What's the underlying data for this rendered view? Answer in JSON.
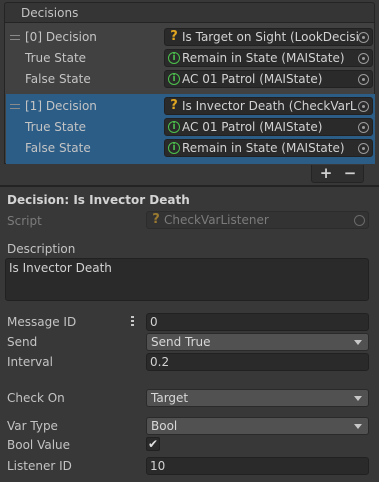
{
  "decisions": {
    "header": "Decisions",
    "items": [
      {
        "label": "[0] Decision",
        "decision_value": "Is Target on Sight (LookDecisi",
        "true_label": "True State",
        "true_value": "Remain in State (MAIState)",
        "false_label": "False State",
        "false_value": "AC 01 Patrol (MAIState)",
        "selected": false
      },
      {
        "label": "[1] Decision",
        "decision_value": "Is Invector Death (CheckVarL",
        "true_label": "True State",
        "true_value": "AC 01 Patrol (MAIState)",
        "false_label": "False State",
        "false_value": "Remain in State (MAIState)",
        "selected": true
      }
    ],
    "add_label": "+",
    "remove_label": "−"
  },
  "inspector": {
    "title": "Decision: Is Invector Death",
    "script_label": "Script",
    "script_value": "CheckVarListener",
    "description_label": "Description",
    "description_value": "Is Invector Death",
    "message_id_label": "Message ID",
    "message_id_value": "0",
    "send_label": "Send",
    "send_value": "Send True",
    "interval_label": "Interval",
    "interval_value": "0.2",
    "check_on_label": "Check On",
    "check_on_value": "Target",
    "var_type_label": "Var Type",
    "var_type_value": "Bool",
    "bool_value_label": "Bool Value",
    "bool_value_checked": true,
    "listener_id_label": "Listener ID",
    "listener_id_value": "10"
  },
  "colors": {
    "selection": "#2c5d87",
    "background": "#383838",
    "script_icon": "#e0a520",
    "state_icon": "#4cc24c"
  },
  "icons": {
    "decision_script": "question-icon",
    "state_asset": "info-circle-icon",
    "object_picker": "object-picker-icon"
  }
}
